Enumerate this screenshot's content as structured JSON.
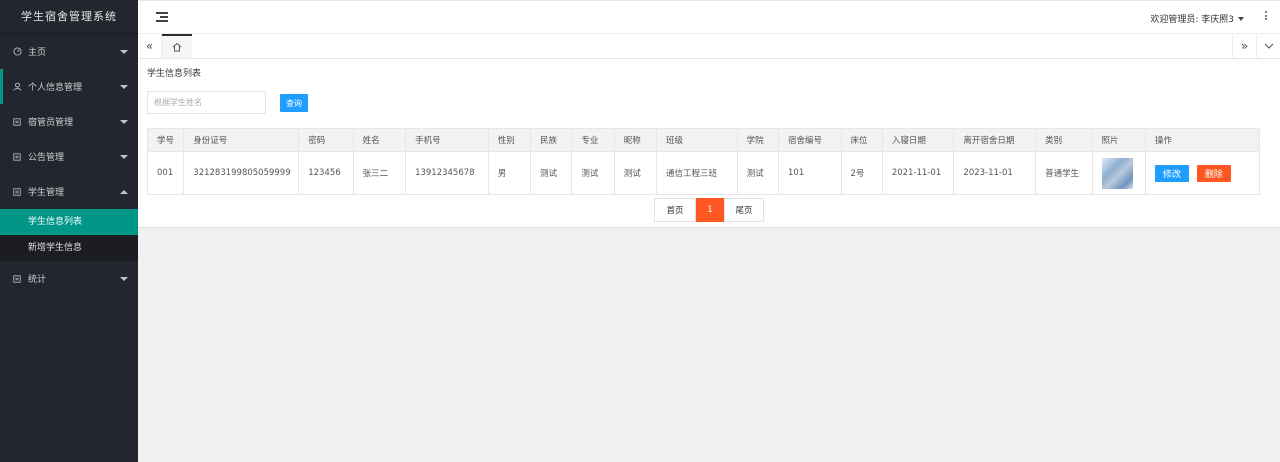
{
  "app": {
    "title": "学生宿舍管理系统"
  },
  "sidebar": {
    "items": [
      {
        "label": "主页",
        "icon": "dashboard-icon"
      },
      {
        "label": "个人信息管理",
        "icon": "user-icon"
      },
      {
        "label": "宿管员管理",
        "icon": "doc-icon"
      },
      {
        "label": "公告管理",
        "icon": "doc-icon"
      },
      {
        "label": "学生管理",
        "icon": "doc-icon"
      },
      {
        "label": "统计",
        "icon": "doc-icon"
      }
    ],
    "sub_items": [
      {
        "label": "学生信息列表",
        "selected": true
      },
      {
        "label": "新增学生信息",
        "selected": false
      }
    ],
    "accent_color": "#009688"
  },
  "header": {
    "user": "欢迎管理员: 李庆照3"
  },
  "content": {
    "breadcrumb": "学生信息列表",
    "search": {
      "placeholder": "根据学生姓名",
      "value": ""
    },
    "search_button": "查询",
    "table": {
      "columns": [
        "学号",
        "身份证号",
        "密码",
        "姓名",
        "手机号",
        "性别",
        "民族",
        "专业",
        "昵称",
        "班级",
        "学院",
        "宿舍编号",
        "床位",
        "入寝日期",
        "离开宿舍日期",
        "类别",
        "照片",
        "操作"
      ],
      "rows": [
        {
          "xuehao": "001",
          "idcard": "321283199805059999",
          "password": "123456",
          "name": "张三二",
          "phone": "13912345678",
          "gender": "男",
          "ethnic": "测试",
          "major": "测试",
          "nickname": "测试",
          "class": "通信工程三班",
          "college": "测试",
          "dorm": "101",
          "bed": "2号",
          "in_date": "2021-11-01",
          "out_date": "2023-11-01",
          "category": "普通学生",
          "edit": "修改",
          "delete": "删除"
        }
      ]
    },
    "pager": {
      "first": "首页",
      "current": "1",
      "last": "尾页"
    }
  },
  "colors": {
    "primary": "#1e9fff",
    "danger": "#ff5722",
    "sidebar_bg": "#23262e"
  }
}
